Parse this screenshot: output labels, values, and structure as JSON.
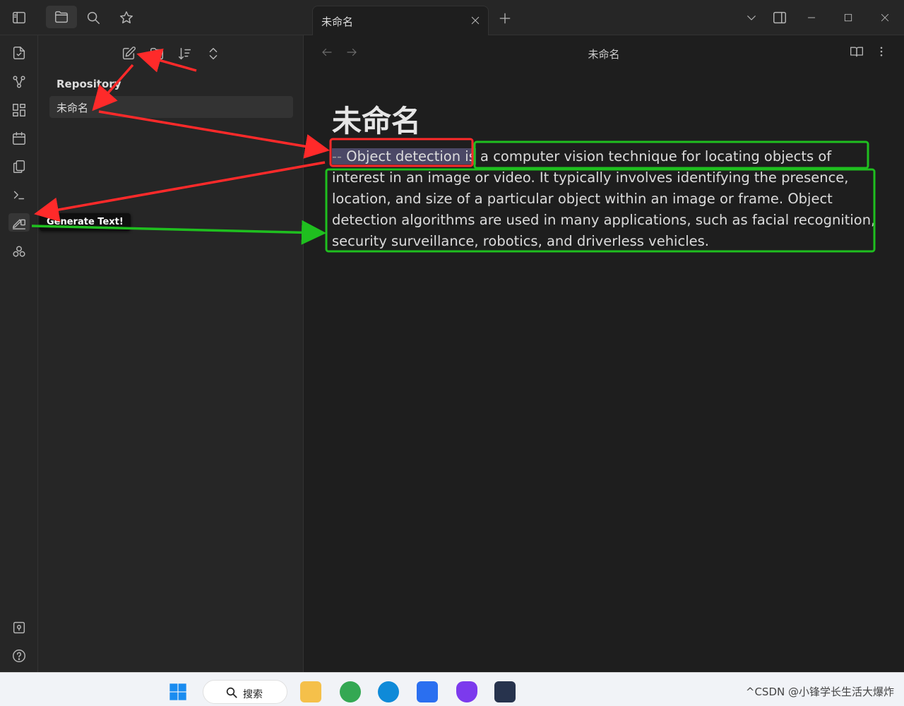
{
  "tab": {
    "title": "未命名"
  },
  "view": {
    "title": "未命名"
  },
  "sidebar": {
    "folder_label": "Repository",
    "file_name": "未命名"
  },
  "note": {
    "title": "未命名",
    "prefix": "--",
    "selected_text": "Object detection is",
    "generated_text": " a computer vision technique for locating objects of interest in an image or video. It typically involves identifying the presence, location, and size of a particular object within an image or frame. Object detection algorithms are used in many applications, such as facial recognition, security surveillance, robotics, and driverless vehicles."
  },
  "tooltip": {
    "label": "Generate Text!"
  },
  "taskbar": {
    "search_label": "搜索",
    "tray_text": "^CSDN @小锋学长生活大爆炸"
  },
  "colors": {
    "annotation_red": "#ff2a2a",
    "annotation_green": "#1fbf1f",
    "selection": "#4b4866"
  },
  "icons": {
    "ribbon": [
      "sidebar-toggle-icon",
      "open-quick-switcher-icon",
      "graph-view-icon",
      "canvas-icon",
      "daily-note-icon",
      "templates-icon",
      "command-palette-icon",
      "generate-text-icon",
      "plugin-icon",
      "vault-switcher-icon",
      "help-icon"
    ],
    "sidebar_tabs": [
      "file-explorer-icon",
      "search-icon",
      "bookmark-icon"
    ],
    "sidebar_actions": [
      "new-note-icon",
      "new-folder-icon",
      "sort-icon",
      "collapse-icon"
    ]
  }
}
